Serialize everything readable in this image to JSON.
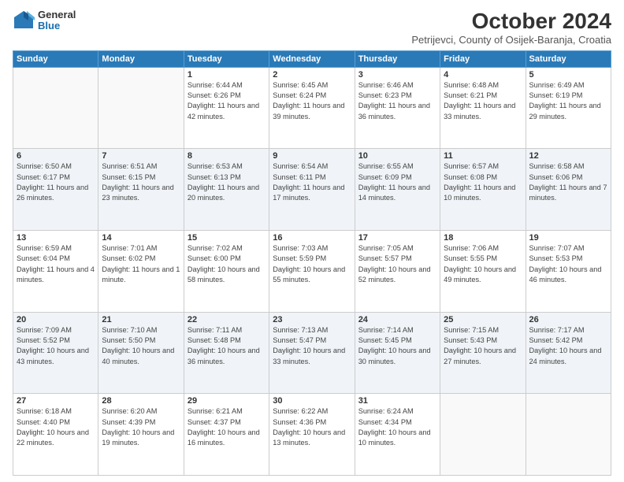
{
  "header": {
    "logo_general": "General",
    "logo_blue": "Blue",
    "month": "October 2024",
    "location": "Petrijevci, County of Osijek-Baranja, Croatia"
  },
  "weekdays": [
    "Sunday",
    "Monday",
    "Tuesday",
    "Wednesday",
    "Thursday",
    "Friday",
    "Saturday"
  ],
  "weeks": [
    [
      {
        "day": "",
        "info": ""
      },
      {
        "day": "",
        "info": ""
      },
      {
        "day": "1",
        "info": "Sunrise: 6:44 AM\nSunset: 6:26 PM\nDaylight: 11 hours and 42 minutes."
      },
      {
        "day": "2",
        "info": "Sunrise: 6:45 AM\nSunset: 6:24 PM\nDaylight: 11 hours and 39 minutes."
      },
      {
        "day": "3",
        "info": "Sunrise: 6:46 AM\nSunset: 6:23 PM\nDaylight: 11 hours and 36 minutes."
      },
      {
        "day": "4",
        "info": "Sunrise: 6:48 AM\nSunset: 6:21 PM\nDaylight: 11 hours and 33 minutes."
      },
      {
        "day": "5",
        "info": "Sunrise: 6:49 AM\nSunset: 6:19 PM\nDaylight: 11 hours and 29 minutes."
      }
    ],
    [
      {
        "day": "6",
        "info": "Sunrise: 6:50 AM\nSunset: 6:17 PM\nDaylight: 11 hours and 26 minutes."
      },
      {
        "day": "7",
        "info": "Sunrise: 6:51 AM\nSunset: 6:15 PM\nDaylight: 11 hours and 23 minutes."
      },
      {
        "day": "8",
        "info": "Sunrise: 6:53 AM\nSunset: 6:13 PM\nDaylight: 11 hours and 20 minutes."
      },
      {
        "day": "9",
        "info": "Sunrise: 6:54 AM\nSunset: 6:11 PM\nDaylight: 11 hours and 17 minutes."
      },
      {
        "day": "10",
        "info": "Sunrise: 6:55 AM\nSunset: 6:09 PM\nDaylight: 11 hours and 14 minutes."
      },
      {
        "day": "11",
        "info": "Sunrise: 6:57 AM\nSunset: 6:08 PM\nDaylight: 11 hours and 10 minutes."
      },
      {
        "day": "12",
        "info": "Sunrise: 6:58 AM\nSunset: 6:06 PM\nDaylight: 11 hours and 7 minutes."
      }
    ],
    [
      {
        "day": "13",
        "info": "Sunrise: 6:59 AM\nSunset: 6:04 PM\nDaylight: 11 hours and 4 minutes."
      },
      {
        "day": "14",
        "info": "Sunrise: 7:01 AM\nSunset: 6:02 PM\nDaylight: 11 hours and 1 minute."
      },
      {
        "day": "15",
        "info": "Sunrise: 7:02 AM\nSunset: 6:00 PM\nDaylight: 10 hours and 58 minutes."
      },
      {
        "day": "16",
        "info": "Sunrise: 7:03 AM\nSunset: 5:59 PM\nDaylight: 10 hours and 55 minutes."
      },
      {
        "day": "17",
        "info": "Sunrise: 7:05 AM\nSunset: 5:57 PM\nDaylight: 10 hours and 52 minutes."
      },
      {
        "day": "18",
        "info": "Sunrise: 7:06 AM\nSunset: 5:55 PM\nDaylight: 10 hours and 49 minutes."
      },
      {
        "day": "19",
        "info": "Sunrise: 7:07 AM\nSunset: 5:53 PM\nDaylight: 10 hours and 46 minutes."
      }
    ],
    [
      {
        "day": "20",
        "info": "Sunrise: 7:09 AM\nSunset: 5:52 PM\nDaylight: 10 hours and 43 minutes."
      },
      {
        "day": "21",
        "info": "Sunrise: 7:10 AM\nSunset: 5:50 PM\nDaylight: 10 hours and 40 minutes."
      },
      {
        "day": "22",
        "info": "Sunrise: 7:11 AM\nSunset: 5:48 PM\nDaylight: 10 hours and 36 minutes."
      },
      {
        "day": "23",
        "info": "Sunrise: 7:13 AM\nSunset: 5:47 PM\nDaylight: 10 hours and 33 minutes."
      },
      {
        "day": "24",
        "info": "Sunrise: 7:14 AM\nSunset: 5:45 PM\nDaylight: 10 hours and 30 minutes."
      },
      {
        "day": "25",
        "info": "Sunrise: 7:15 AM\nSunset: 5:43 PM\nDaylight: 10 hours and 27 minutes."
      },
      {
        "day": "26",
        "info": "Sunrise: 7:17 AM\nSunset: 5:42 PM\nDaylight: 10 hours and 24 minutes."
      }
    ],
    [
      {
        "day": "27",
        "info": "Sunrise: 6:18 AM\nSunset: 4:40 PM\nDaylight: 10 hours and 22 minutes."
      },
      {
        "day": "28",
        "info": "Sunrise: 6:20 AM\nSunset: 4:39 PM\nDaylight: 10 hours and 19 minutes."
      },
      {
        "day": "29",
        "info": "Sunrise: 6:21 AM\nSunset: 4:37 PM\nDaylight: 10 hours and 16 minutes."
      },
      {
        "day": "30",
        "info": "Sunrise: 6:22 AM\nSunset: 4:36 PM\nDaylight: 10 hours and 13 minutes."
      },
      {
        "day": "31",
        "info": "Sunrise: 6:24 AM\nSunset: 4:34 PM\nDaylight: 10 hours and 10 minutes."
      },
      {
        "day": "",
        "info": ""
      },
      {
        "day": "",
        "info": ""
      }
    ]
  ]
}
